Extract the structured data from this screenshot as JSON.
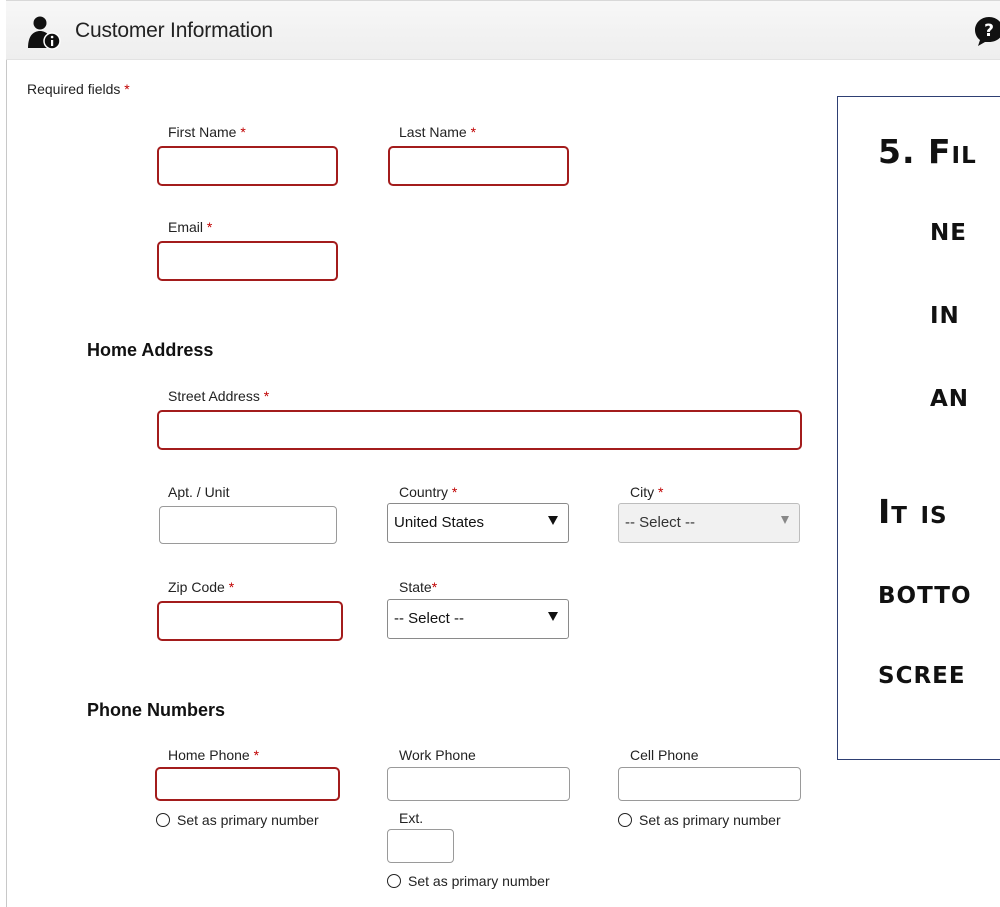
{
  "header": {
    "title": "Customer Information",
    "icon": "customer-info-icon",
    "help_icon": "help-icon"
  },
  "required_note": {
    "text": "Required fields",
    "star": "*"
  },
  "labels": {
    "first_name": "First Name",
    "last_name": "Last Name",
    "email": "Email",
    "street_address": "Street Address",
    "apt_unit": "Apt. / Unit",
    "country": "Country",
    "city": "City",
    "zip_code": "Zip Code",
    "state": "State",
    "home_phone": "Home Phone",
    "work_phone": "Work Phone",
    "cell_phone": "Cell Phone",
    "ext": "Ext.",
    "star": "*"
  },
  "sections": {
    "home_address": "Home Address",
    "phone_numbers": "Phone Numbers"
  },
  "fields": {
    "first_name": "",
    "last_name": "",
    "email": "",
    "street_address": "",
    "apt_unit": "",
    "zip_code": "",
    "home_phone": "",
    "work_phone": "",
    "cell_phone": "",
    "ext": ""
  },
  "selects": {
    "country": "United States",
    "city": "-- Select --",
    "state": "-- Select --"
  },
  "radio": {
    "primary_label": "Set as primary number"
  },
  "callout": {
    "lines": [
      "5. Fil",
      "ne",
      "in",
      "an",
      "It is",
      "botto",
      "scree"
    ]
  },
  "colors": {
    "required_border": "#a31c1c",
    "required_star": "#c00000",
    "callout_border": "#2e3f73"
  }
}
